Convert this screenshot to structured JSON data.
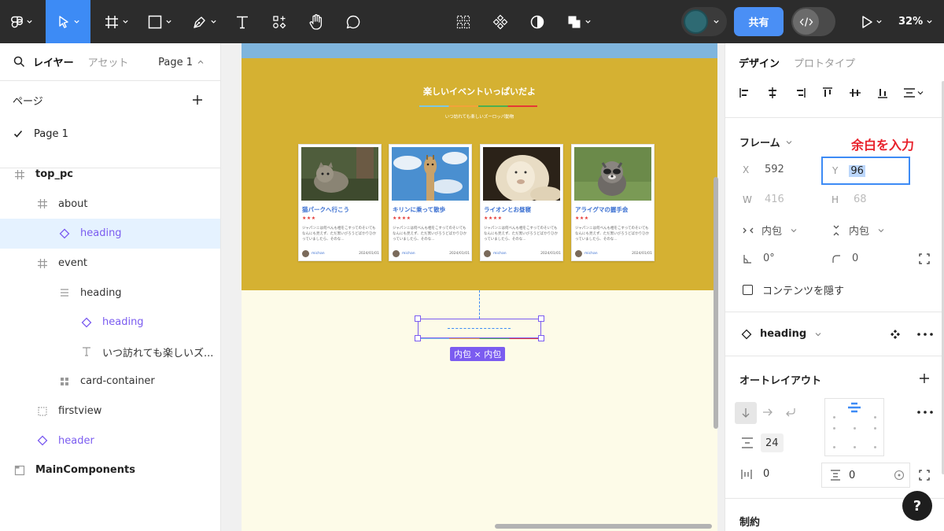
{
  "toolbar": {
    "share_label": "共有",
    "zoom_label": "32%"
  },
  "left_panel": {
    "tab_layers": "レイヤー",
    "tab_assets": "アセット",
    "page_select": "Page 1",
    "pages_header": "ページ",
    "pages": [
      {
        "label": "Page 1",
        "checked": true
      }
    ],
    "layers": [
      {
        "label": "top_pc",
        "type": "frame",
        "indent": 0,
        "bold": true
      },
      {
        "label": "about",
        "type": "frame",
        "indent": 1
      },
      {
        "label": "heading",
        "type": "component",
        "indent": 2,
        "selected": true
      },
      {
        "label": "event",
        "type": "frame",
        "indent": 1
      },
      {
        "label": "heading",
        "type": "autolayout",
        "indent": 2
      },
      {
        "label": "heading",
        "type": "component",
        "indent": 3
      },
      {
        "label": "いつ訪れても楽しいズ...",
        "type": "text",
        "indent": 3
      },
      {
        "label": "card-container",
        "type": "grid",
        "indent": 2
      },
      {
        "label": "firstview",
        "type": "dashed-frame",
        "indent": 1
      },
      {
        "label": "header",
        "type": "component",
        "indent": 1
      },
      {
        "label": "MainComponents",
        "type": "section",
        "indent": 0,
        "bold": true
      }
    ]
  },
  "canvas": {
    "event_title": "楽しいイベントいっぱいだよ",
    "event_subtitle": "いつ訪れても楽しいズーロッパ動物",
    "cards": [
      {
        "title": "猫パークへ行こう",
        "stars": "★★★",
        "body": "ジャパンニは何べんも相をこすってのそいてもなんにも見えず、ただ黒いびろうどばかりひかっていましたら、そのな...",
        "author": "michan",
        "date": "2024/01/01",
        "image": "cat"
      },
      {
        "title": "キリンに乗って散歩",
        "stars": "★★★★",
        "body": "ジャパンニは何べんも相をこすってのそいてもなんにも見えず、ただ黒いびろうどばかりひかっていましたら、そのな...",
        "author": "michan",
        "date": "2024/01/01",
        "image": "giraffe"
      },
      {
        "title": "ライオンとお昼寝",
        "stars": "★★★★",
        "body": "ジャパンニは何べんも相をこすってのそいてもなんにも見えず、ただ黒いびろうどばかりひかっていましたら、そのな...",
        "author": "michan",
        "date": "2024/01/01",
        "image": "lion"
      },
      {
        "title": "アライグマの握手会",
        "stars": "★★★",
        "body": "ジャパンニは何べんも相をこすってのそいてもなんにも見えず、ただ黒いびろうどばかりひかっていましたら、そのな...",
        "author": "michan",
        "date": "2024/01/01",
        "image": "raccoon"
      }
    ],
    "selection_badge": "内包 × 内包"
  },
  "right_panel": {
    "tab_design": "デザイン",
    "tab_prototype": "プロトタイプ",
    "frame_title": "フレーム",
    "annotation": "余白を入力",
    "x_label": "X",
    "x_value": "592",
    "y_label": "Y",
    "y_value": "96",
    "w_label": "W",
    "w_value": "416",
    "h_label": "H",
    "h_value": "68",
    "width_mode": "内包",
    "height_mode": "内包",
    "rotation": "0°",
    "radius": "0",
    "clip_label": "コンテンツを隠す",
    "component_name": "heading",
    "autolayout_title": "オートレイアウト",
    "gap_value": "24",
    "padding_h": "0",
    "padding_v": "0",
    "constraints_title": "制約"
  },
  "help_label": "?"
}
